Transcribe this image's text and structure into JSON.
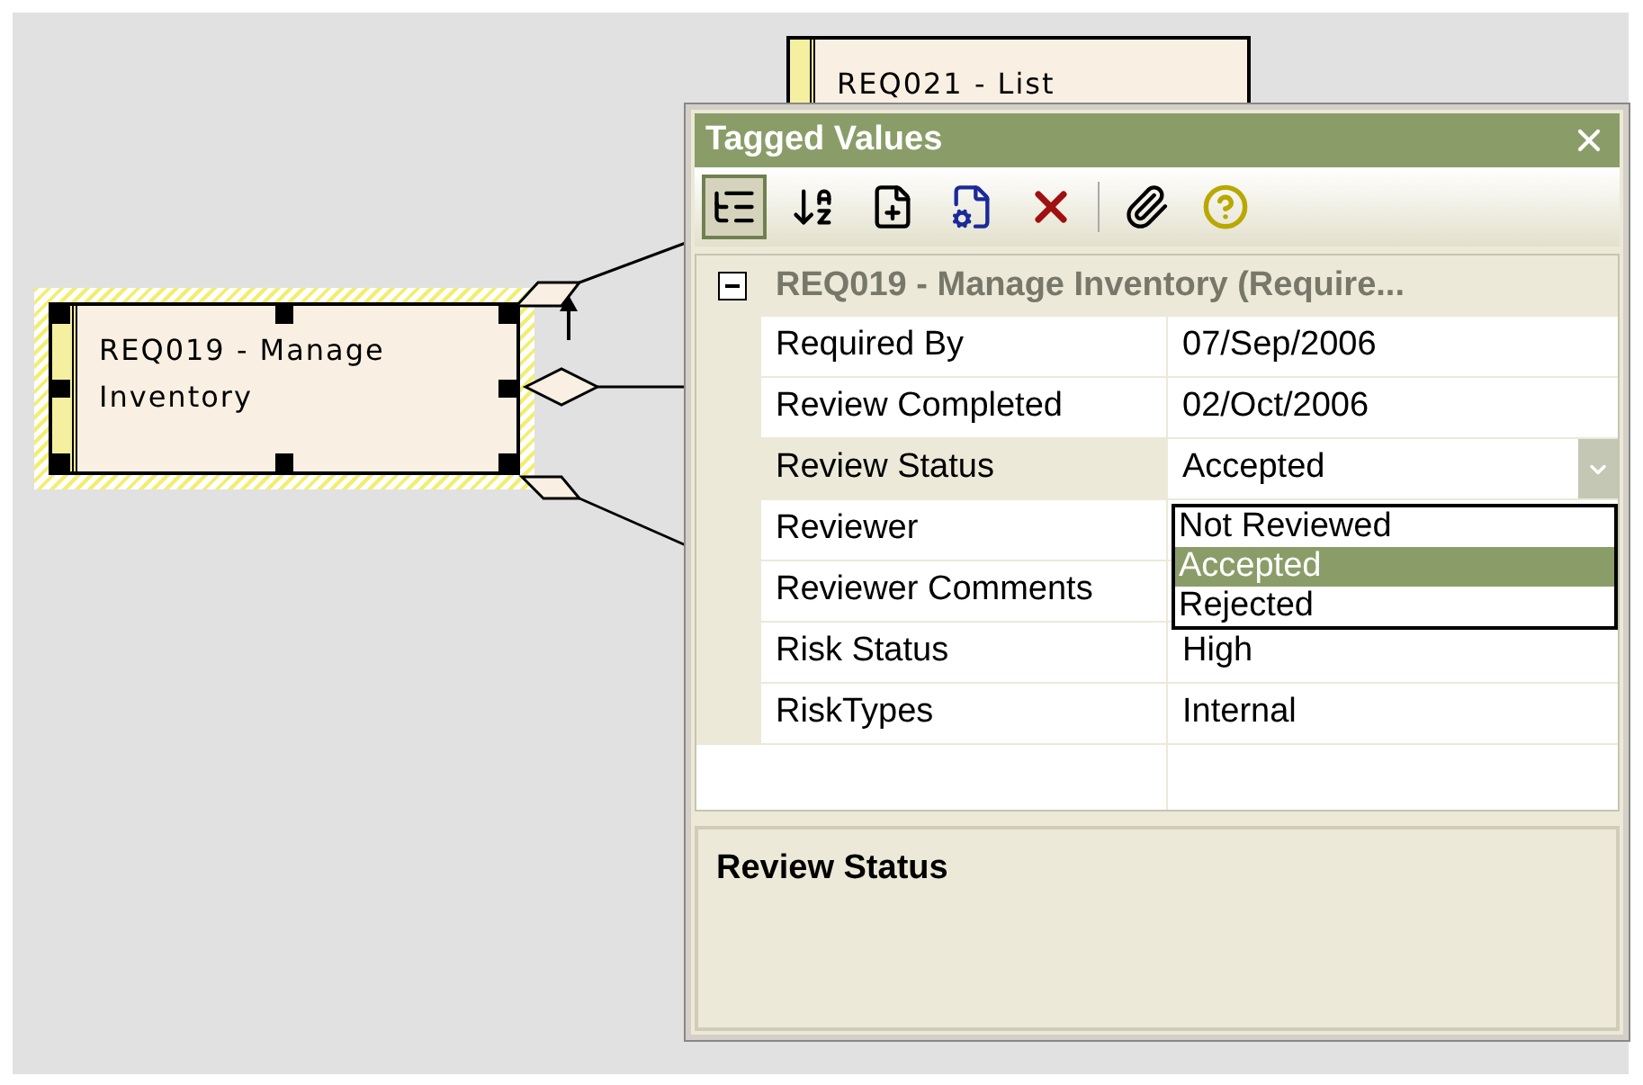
{
  "diagram": {
    "elements": [
      {
        "label": "REQ021 - List",
        "selected": false
      },
      {
        "label": "REQ019 - Manage Inventory",
        "selected": true
      }
    ]
  },
  "window": {
    "title": "Tagged Values"
  },
  "toolbar": [
    {
      "kind": "categorized",
      "pressed": true
    },
    {
      "kind": "sort",
      "pressed": false
    },
    {
      "kind": "new",
      "pressed": false
    },
    {
      "kind": "properties",
      "pressed": false
    },
    {
      "kind": "delete",
      "pressed": false
    },
    {
      "kind": "attach",
      "pressed": false
    },
    {
      "kind": "help",
      "pressed": false
    }
  ],
  "grid": {
    "category": {
      "label": "REQ019 - Manage Inventory (Require...",
      "expanded": true
    },
    "rows": [
      {
        "name": "Required By",
        "value": "07/Sep/2006",
        "selected": false
      },
      {
        "name": "Review Completed",
        "value": "02/Oct/2006",
        "selected": false
      },
      {
        "name": "Review Status",
        "value": "Accepted",
        "selected": true,
        "dropdown": [
          {
            "label": "Not Reviewed",
            "selected": false
          },
          {
            "label": "Accepted",
            "selected": true
          },
          {
            "label": "Rejected",
            "selected": false
          }
        ]
      },
      {
        "name": "Reviewer",
        "selected": false
      },
      {
        "name": "Reviewer Comments",
        "selected": false
      },
      {
        "name": "Risk Status",
        "value": "High",
        "selected": false
      },
      {
        "name": "RiskTypes",
        "value": "Internal",
        "selected": false
      }
    ]
  },
  "description": {
    "title": "Review Status"
  }
}
